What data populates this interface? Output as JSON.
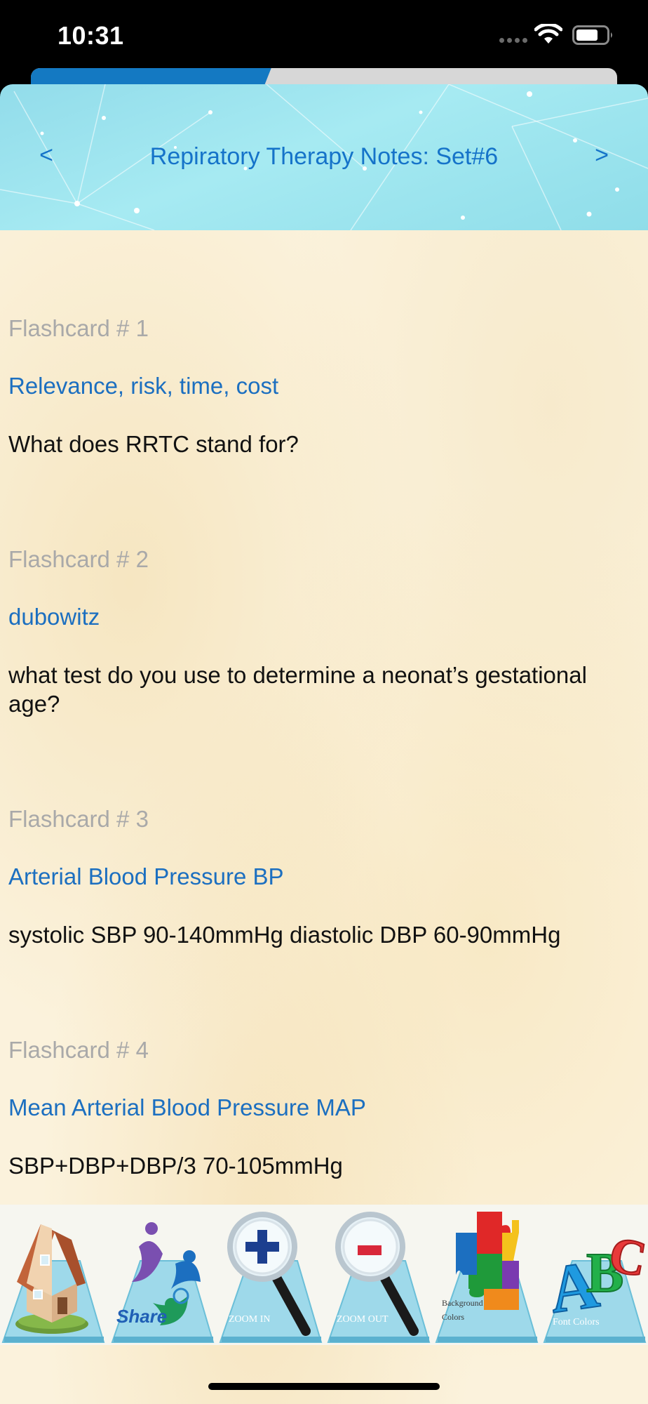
{
  "status": {
    "time": "10:31"
  },
  "progress": {
    "fraction": 0.41
  },
  "header": {
    "title": "Repiratory Therapy Notes: Set#6",
    "prev_label": "<",
    "next_label": ">"
  },
  "cards": [
    {
      "number": "Flashcard # 1",
      "answer": "Relevance, risk, time, cost",
      "question": "What does RRTC stand for?"
    },
    {
      "number": "Flashcard # 2",
      "answer": "dubowitz",
      "question": "what test do you use to determine a neonat’s gestational age?"
    },
    {
      "number": "Flashcard # 3",
      "answer": "Arterial Blood Pressure BP",
      "question": "systolic SBP 90-140mmHg diastolic DBP 60-90mmHg"
    },
    {
      "number": "Flashcard # 4",
      "answer": "Mean Arterial Blood Pressure MAP",
      "question": "SBP+DBP+DBP/3 70-105mmHg"
    }
  ],
  "toolbar": {
    "share_label": "Share",
    "zoom_in_label": "ZOOM IN",
    "zoom_out_label": "ZOOM OUT",
    "background_colors_label": "Background Colors",
    "font_colors_label": "Font Colors",
    "font_letters": "ABC"
  },
  "colors": {
    "accent": "#1573c9",
    "progress": "#1479c2",
    "answer": "#1c6fc0",
    "card_number": "#a9a9a9"
  }
}
